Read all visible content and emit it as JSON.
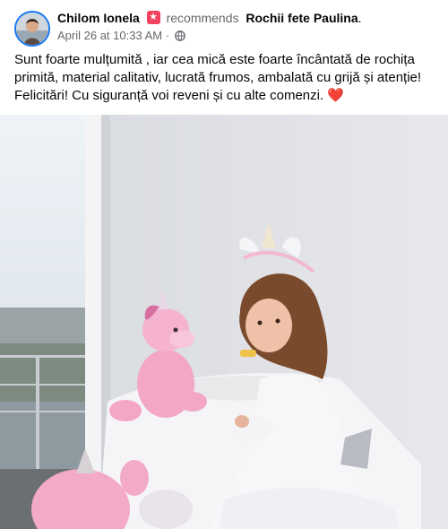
{
  "post": {
    "author": "Chilom Ionela",
    "action": "recommends",
    "page_name": "Rochii fete Paulina",
    "punct": ".",
    "timestamp": "April 26 at 10:33 AM",
    "separator": "·",
    "privacy_icon": "globe-icon",
    "recommend_icon": "recommend-star-icon",
    "text_lines": [
      "Sunt foarte mulțumită , iar cea mică este foarte încântată de rochița",
      "primită,  material calitativ,  lucrată frumos, ambalată cu grijă și atenție!",
      "Felicitări! Cu siguranță voi reveni și cu alte comenzi."
    ],
    "heart": "❤️"
  },
  "colors": {
    "text_primary": "#050505",
    "text_secondary": "#65676b",
    "recommend_badge": "#f3425f",
    "avatar_ring": "#1877f2"
  }
}
